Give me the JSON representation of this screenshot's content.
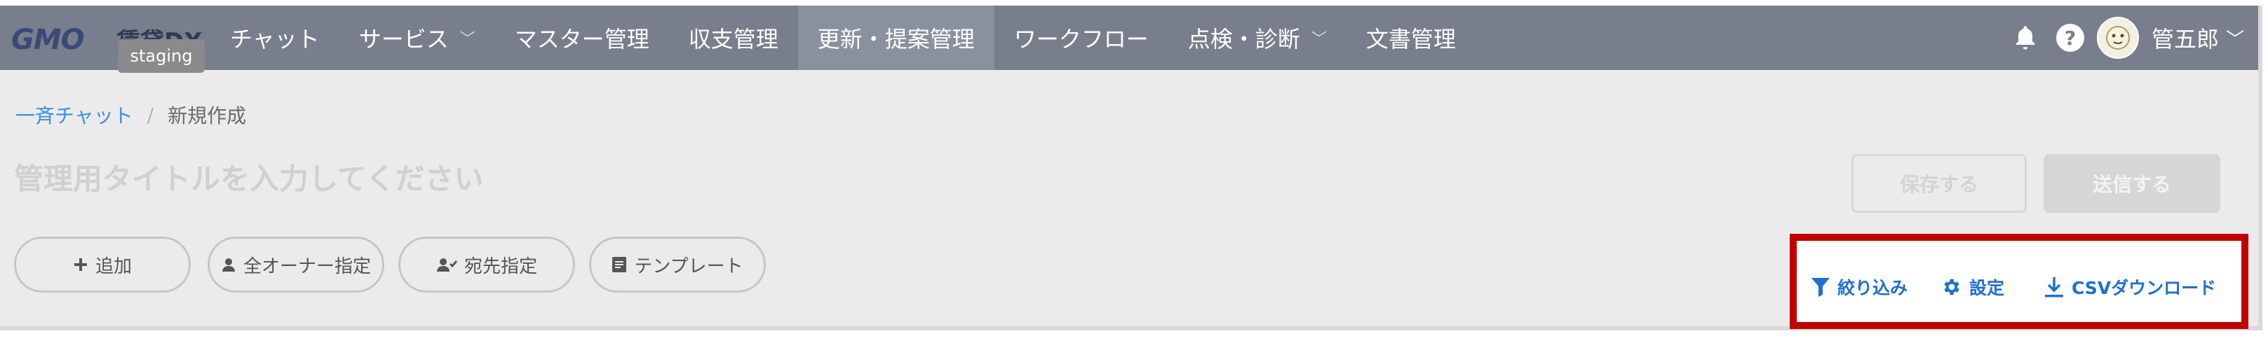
{
  "header": {
    "brand": "GMO",
    "product": "賃貸DX",
    "env_badge": "staging",
    "nav": [
      {
        "label": "チャット",
        "has_dropdown": false,
        "active": false
      },
      {
        "label": "サービス",
        "has_dropdown": true,
        "active": false
      },
      {
        "label": "マスター管理",
        "has_dropdown": false,
        "active": false
      },
      {
        "label": "収支管理",
        "has_dropdown": false,
        "active": false
      },
      {
        "label": "更新・提案管理",
        "has_dropdown": false,
        "active": true
      },
      {
        "label": "ワークフロー",
        "has_dropdown": false,
        "active": false
      },
      {
        "label": "点検・診断",
        "has_dropdown": true,
        "active": false
      },
      {
        "label": "文書管理",
        "has_dropdown": false,
        "active": false
      }
    ],
    "help_glyph": "?",
    "username": "管五郎"
  },
  "breadcrumb": {
    "parent": "一斉チャット",
    "separator": "/",
    "current": "新規作成"
  },
  "title_field": {
    "placeholder": "管理用タイトルを入力してください",
    "value": ""
  },
  "actions": {
    "save": "保存する",
    "send": "送信する"
  },
  "pills": {
    "add": "追加",
    "all_owners": "全オーナー指定",
    "recipients": "宛先指定",
    "template": "テンプレート"
  },
  "tools": {
    "filter": "絞り込み",
    "settings": "設定",
    "csv_download": "CSVダウンロード"
  },
  "colors": {
    "header_bg": "#787e8c",
    "link_blue": "#3a8ee6",
    "tool_blue": "#1f6fd1",
    "highlight_red": "#c00000"
  }
}
